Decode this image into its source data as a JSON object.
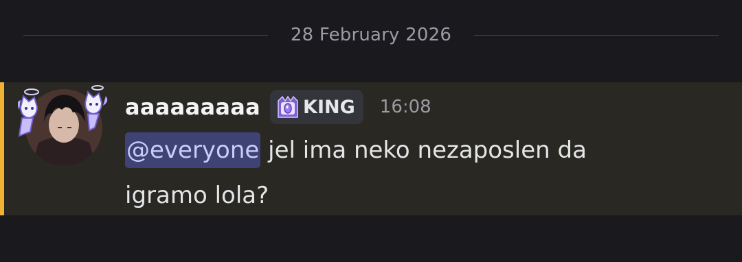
{
  "date_divider": "28 February 2026",
  "message": {
    "author": "aaaaaaaaa",
    "role": {
      "name": "KING",
      "icon": "crown-gem-icon",
      "icon_color": "#a98bf2"
    },
    "timestamp": "16:08",
    "mention": "@everyone",
    "line1_text": " jel ima neko nezaposlen da",
    "line2_text": "igramo lola?",
    "highlight_bar_color": "#f0b232",
    "mention_bg_color": "#3e4275"
  }
}
